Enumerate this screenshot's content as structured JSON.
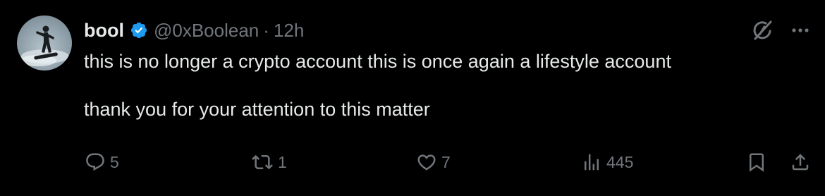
{
  "author": {
    "name": "bool",
    "handle": "@0xBoolean",
    "separator": "·",
    "time": "12h",
    "verified": true,
    "verified_color": "#1d9bf0"
  },
  "post": {
    "line1": "this is no longer a crypto account this is once again a lifestyle account",
    "line2": "thank you for your attention to this matter"
  },
  "actions": {
    "replies": "5",
    "reposts": "1",
    "likes": "7",
    "views": "445"
  },
  "icons": {
    "grok": "grok-icon",
    "more": "more-icon",
    "reply": "reply-icon",
    "repost": "repost-icon",
    "like": "heart-icon",
    "views": "views-icon",
    "bookmark": "bookmark-icon",
    "share": "share-icon"
  },
  "colors": {
    "background": "#000000",
    "text": "#e7e9ea",
    "muted": "#71767b",
    "accent": "#1d9bf0"
  }
}
